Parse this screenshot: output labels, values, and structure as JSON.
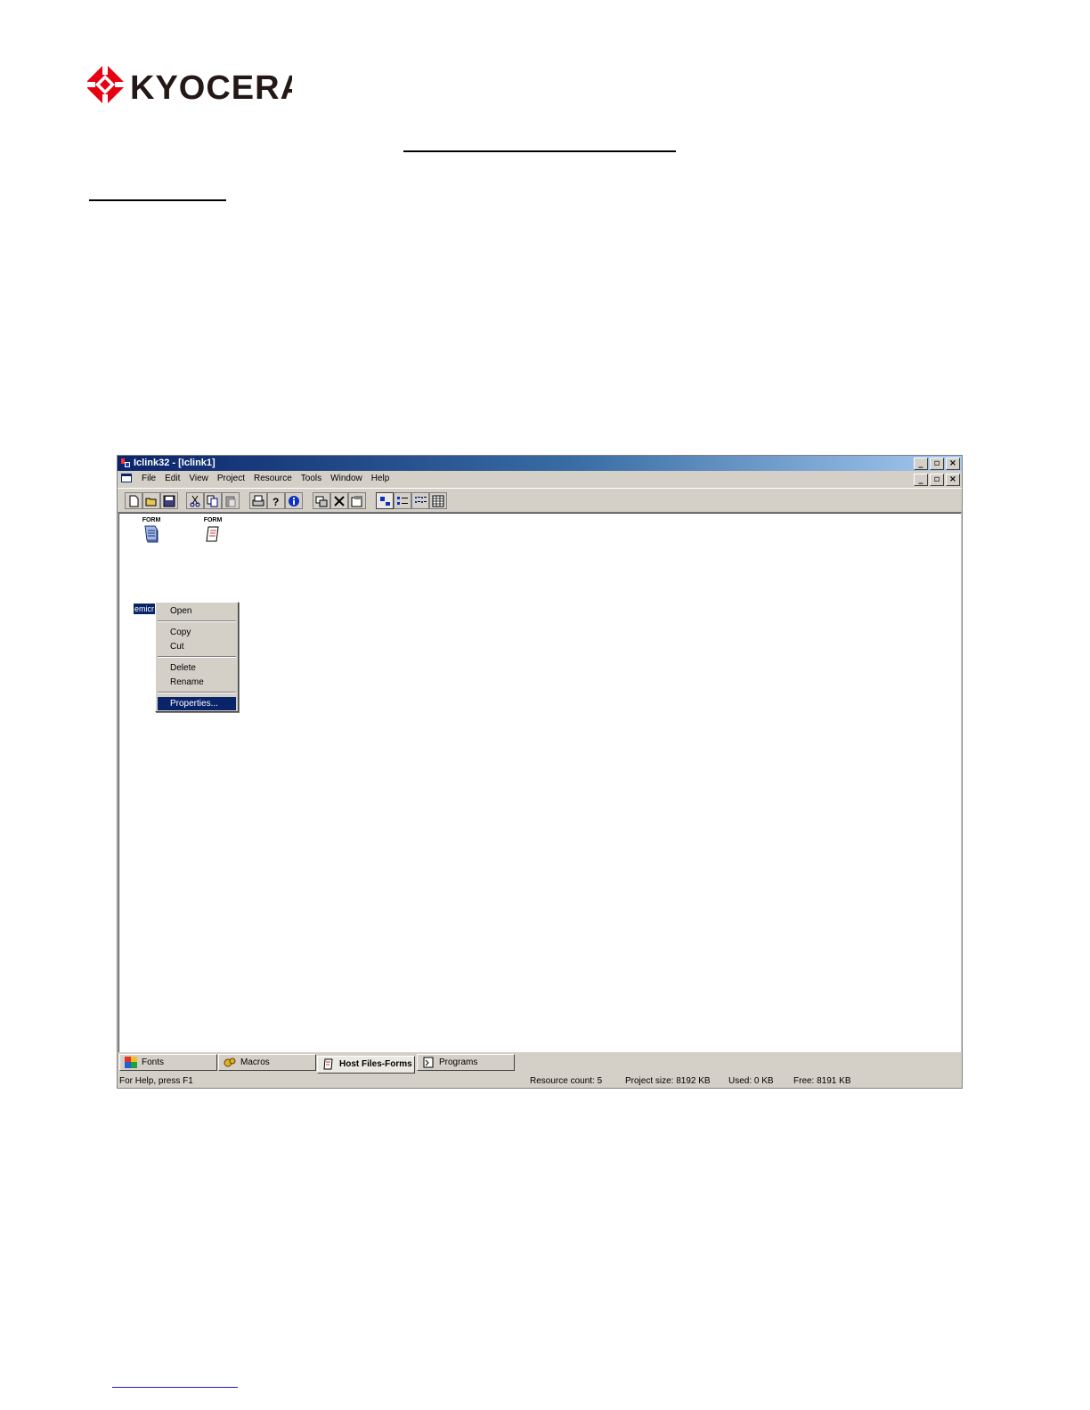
{
  "brand": {
    "name": "KYOCERA",
    "color": "#e60012"
  },
  "window": {
    "title": "Iclink32 - [Iclink1]",
    "caption_buttons": [
      "_",
      "▫",
      "×"
    ],
    "menu": [
      "File",
      "Edit",
      "View",
      "Project",
      "Resource",
      "Tools",
      "Window",
      "Help"
    ]
  },
  "toolbar": {
    "icons": [
      "new-file-icon",
      "open-folder-icon",
      "save-icon",
      "cut-icon",
      "copy-icon",
      "paste-icon",
      "print-icon",
      "help-icon",
      "info-icon",
      "send-icon",
      "delete-icon",
      "properties-icon",
      "large-icons-view-icon",
      "small-icons-view-icon",
      "list-view-icon",
      "details-view-icon"
    ]
  },
  "resources": [
    {
      "type": "FORM",
      "label": "emicr"
    },
    {
      "type": "FORM",
      "label": ""
    }
  ],
  "context_menu": {
    "items": [
      "Open",
      "Copy",
      "Cut",
      "Delete",
      "Rename",
      "Properties..."
    ],
    "selected": "Properties..."
  },
  "tabs": [
    {
      "label": "Fonts",
      "icon": "fonts-icon"
    },
    {
      "label": "Macros",
      "icon": "macros-icon"
    },
    {
      "label": "Host Files-Forms",
      "icon": "forms-icon",
      "active": true
    },
    {
      "label": "Programs",
      "icon": "programs-icon"
    }
  ],
  "status": {
    "help": "For Help, press F1",
    "resource_count": "Resource count:  5",
    "project_size": "Project size: 8192 KB",
    "used": "Used: 0 KB",
    "free": "Free: 8191 KB"
  }
}
